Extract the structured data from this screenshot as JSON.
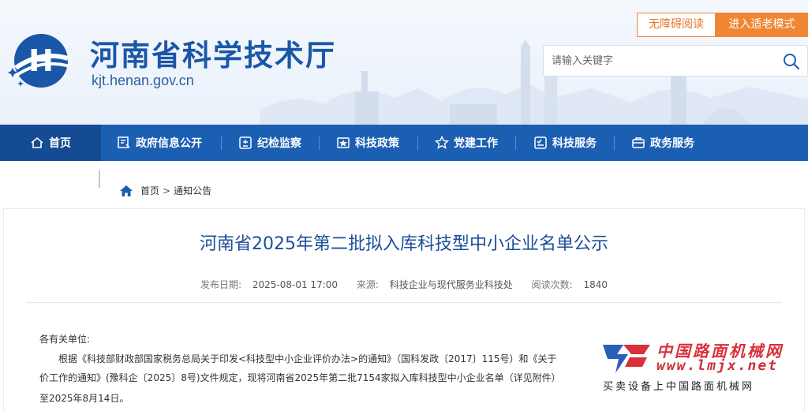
{
  "header": {
    "site_title": "河南省科学技术厅",
    "site_domain": "kjt.henan.gov.cn",
    "accessibility_label": "无障碍阅读",
    "elder_mode_label": "进入适老模式",
    "search_placeholder": "请输入关键字",
    "logo_letter": "H"
  },
  "nav": {
    "items": [
      {
        "label": "首页",
        "icon": "home-icon"
      },
      {
        "label": "政府信息公开",
        "icon": "disclosure-icon"
      },
      {
        "label": "纪检监察",
        "icon": "inspection-icon"
      },
      {
        "label": "科技政策",
        "icon": "policy-icon"
      },
      {
        "label": "党建工作",
        "icon": "star-icon"
      },
      {
        "label": "科技服务",
        "icon": "service-icon"
      },
      {
        "label": "政务服务",
        "icon": "briefcase-icon"
      }
    ],
    "active_index": 0
  },
  "breadcrumb": {
    "home": "首页",
    "separator": ">",
    "current": "通知公告"
  },
  "article": {
    "title": "河南省2025年第二批拟入库科技型中小企业名单公示",
    "date_label": "发布日期:",
    "date_value": "2025-08-01 17:00",
    "source_label": "来源:",
    "source_value": "科技企业与现代服务业科技处",
    "views_label": "阅读次数:",
    "views_value": "1840",
    "salutation": "各有关单位:",
    "line1": "根据《科技部财政部国家税务总局关于印发<科技型中小企业评价办法>的通知》（国科发政〔2017〕115号）和《关于",
    "line2": "价工作的通知》(豫科企〔2025〕8号)文件规定，现将河南省2025年第二批7154家拟入库科技型中小企业名单（详见附件）",
    "line3": "至2025年8月14日。"
  },
  "watermark": {
    "brand_cn": "中国路面机械网",
    "url": "www.lmjx.net",
    "slogan": "买卖设备上中国路面机械网"
  },
  "colors": {
    "primary": "#1b5fb3",
    "nav_active": "#144b92",
    "title_blue": "#1d4d9a",
    "accent_orange": "#f08634",
    "watermark_red": "#d9303b"
  }
}
